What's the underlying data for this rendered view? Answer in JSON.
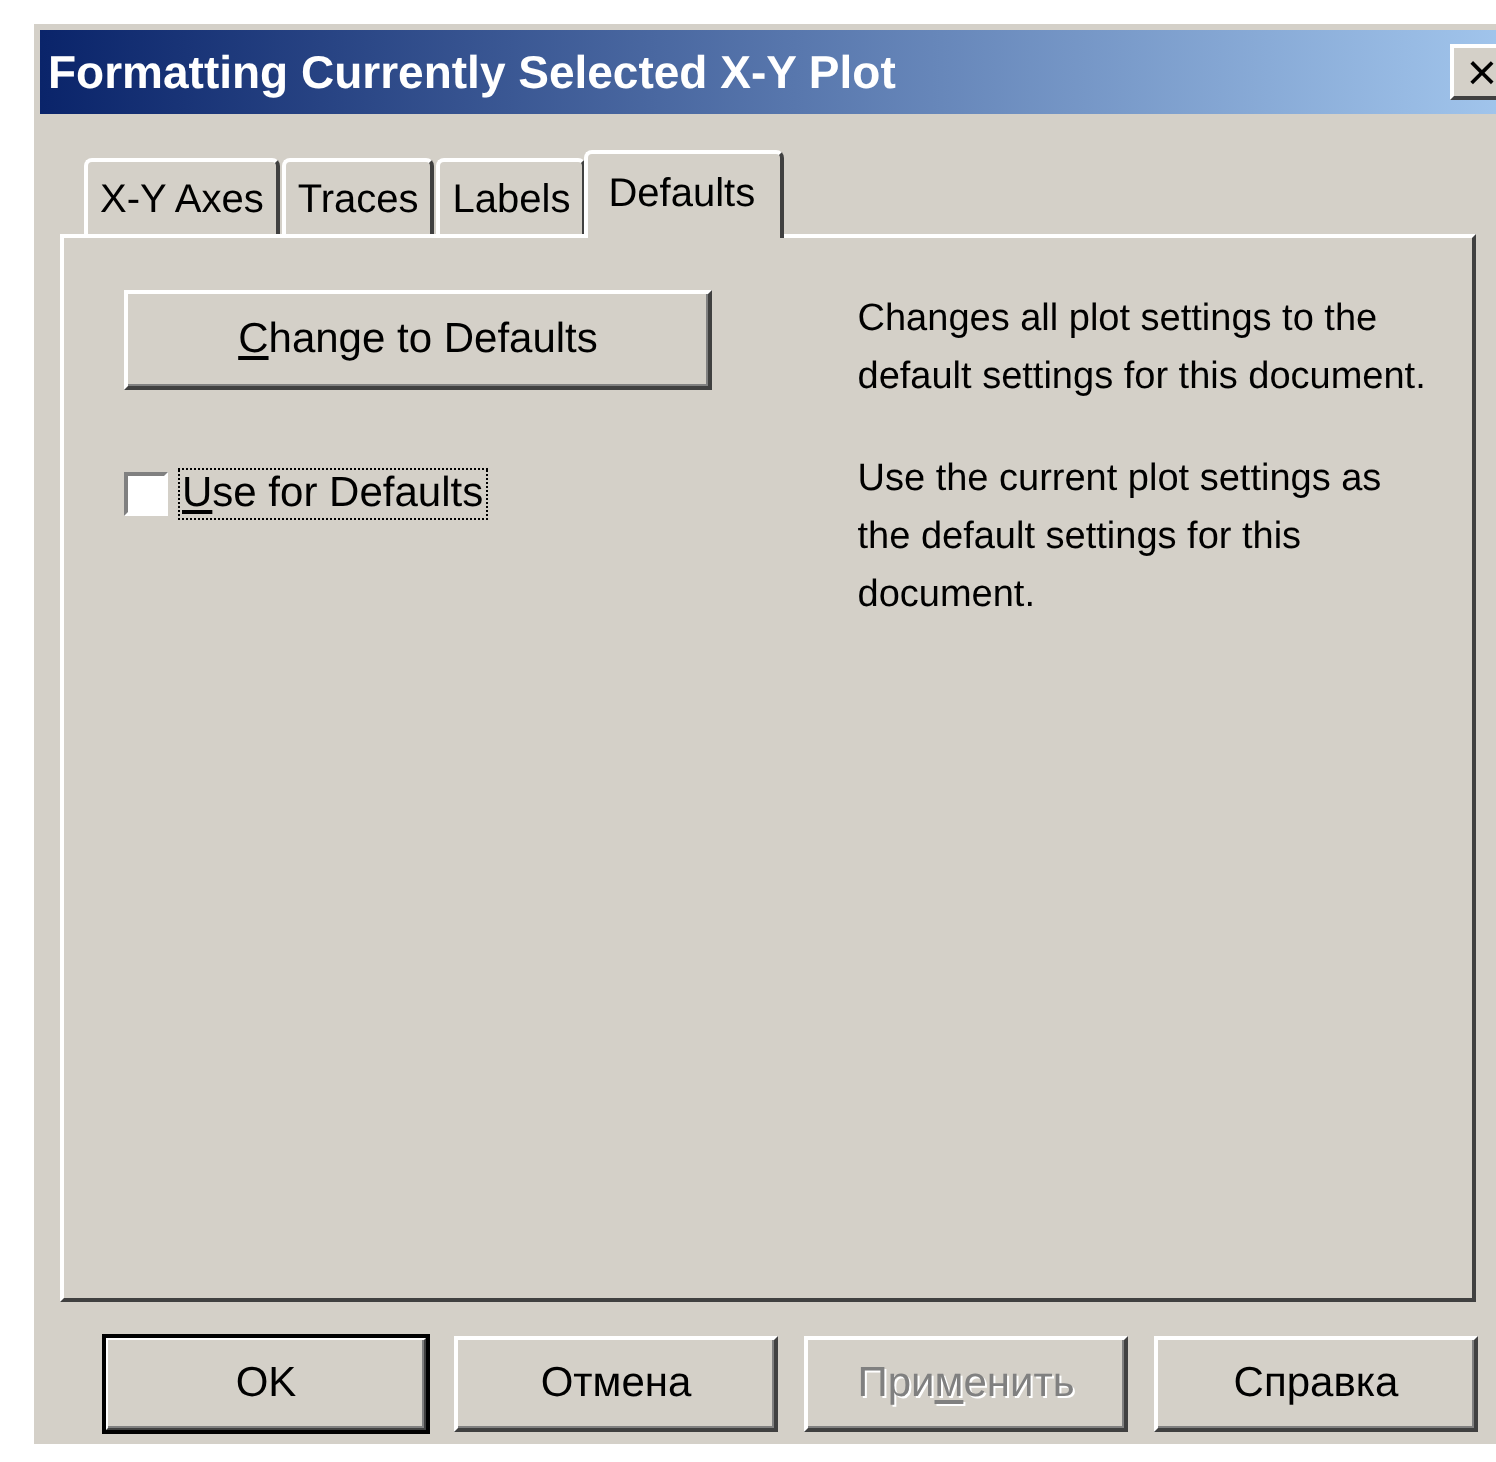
{
  "window": {
    "title": "Formatting Currently Selected X-Y Plot",
    "close": "×"
  },
  "tabs": [
    {
      "label": "X-Y Axes",
      "selected": false
    },
    {
      "label": "Traces",
      "selected": false
    },
    {
      "label": "Labels",
      "selected": false
    },
    {
      "label": "Defaults",
      "selected": true
    }
  ],
  "options": [
    {
      "kind": "button",
      "access_key": "C",
      "label_end": "hange to Defaults",
      "description": "Changes all plot settings to the default settings for this document."
    },
    {
      "kind": "checkbox",
      "access_key": "U",
      "label_end": "se for Defaults",
      "checked": false,
      "focused": true,
      "description": "Use the current plot settings as the default settings for this document."
    }
  ],
  "buttons": [
    {
      "label_start": "OK",
      "default": true,
      "disabled": false
    },
    {
      "label_start": "Отмена",
      "default": false,
      "disabled": false
    },
    {
      "label_start": "При",
      "access_key": "м",
      "label_end": "енить",
      "default": false,
      "disabled": true
    },
    {
      "label_start": "Справка",
      "default": false,
      "disabled": false
    }
  ]
}
